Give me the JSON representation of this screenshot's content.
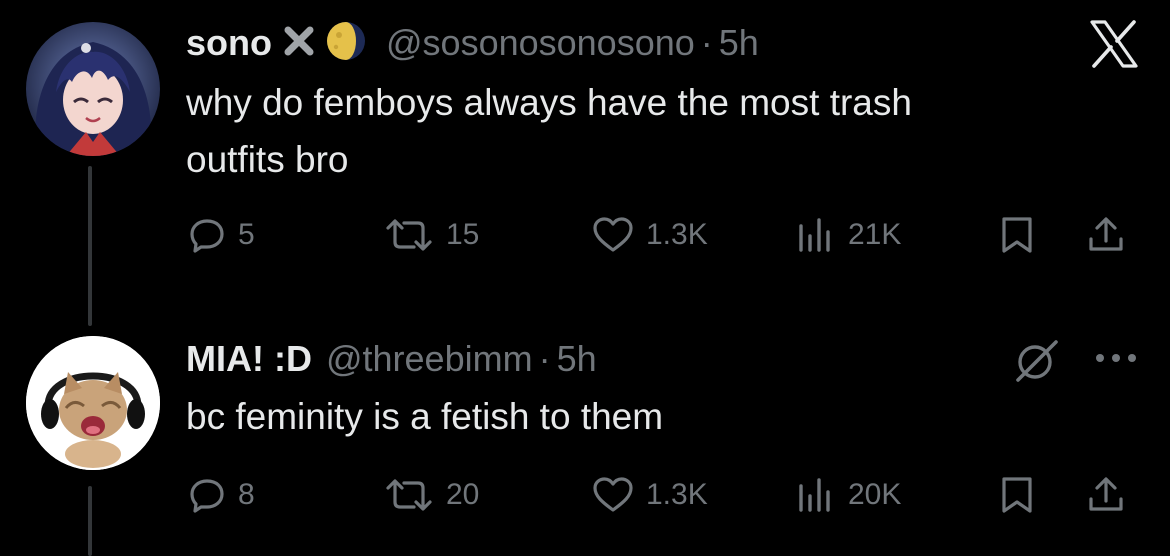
{
  "tweets": [
    {
      "name": "sono",
      "handle": "@sosonosonosono",
      "separator": "·",
      "time": "5h",
      "text_line1": "why do femboys always have the most trash",
      "text_line2": "outfits bro",
      "replies": "5",
      "reposts": "15",
      "likes": "1.3K",
      "views": "21K",
      "badges": [
        "x-badge-icon",
        "moon-phase-icon"
      ],
      "top_right_icon": "x-logo-icon"
    },
    {
      "name": "MIA! :D",
      "handle": "@threebimm",
      "separator": "·",
      "time": "5h",
      "text": "bc feminity is a fetish to them",
      "replies": "8",
      "reposts": "20",
      "likes": "1.3K",
      "views": "20K",
      "top_right_icons": [
        "grok-icon",
        "more-icon"
      ]
    }
  ],
  "colors": {
    "background": "#000000",
    "primary_text": "#e7e9ea",
    "secondary_text": "#71767b",
    "thread_line": "#333639"
  }
}
